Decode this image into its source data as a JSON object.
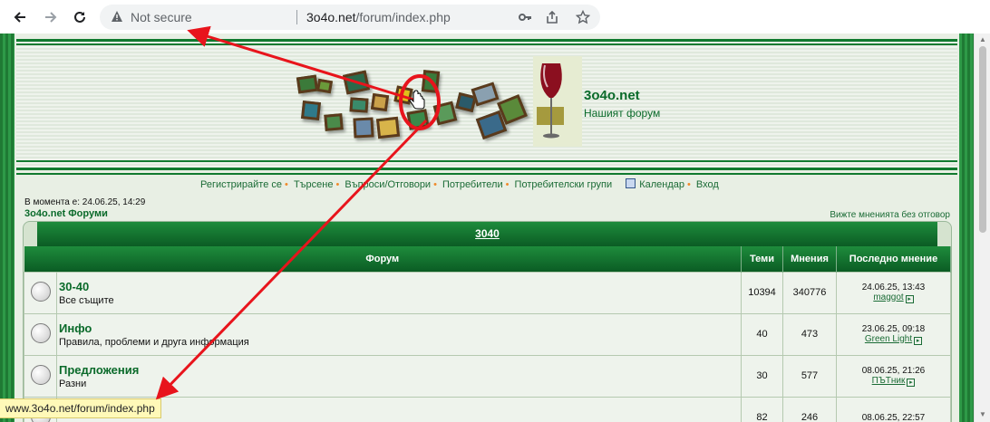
{
  "browser": {
    "security_label": "Not secure",
    "url_host": "3o4o.net",
    "url_path": "/forum/index.php",
    "status_url": "www.3o4o.net/forum/index.php"
  },
  "site": {
    "title": "3o4o.net",
    "subtitle": "Нашият форум"
  },
  "nav": {
    "items": [
      "Регистрирайте се",
      "Търсене",
      "Въпроси/Отговори",
      "Потребители",
      "Потребителски групи",
      "Календар",
      "Вход"
    ]
  },
  "board": {
    "current_time": "В момента е: 24.06.25, 14:29",
    "forums_link": "3o4o.net Форуми",
    "unanswered_link": "Вижте мненията без отговор",
    "category": "3040",
    "columns": {
      "forum": "Форум",
      "topics": "Теми",
      "posts": "Мнения",
      "last_post": "Последно мнение"
    },
    "forums": [
      {
        "name": "30-40",
        "description": "Все същите",
        "topics": "10394",
        "posts": "340776",
        "last_date": "24.06.25, 13:43",
        "last_user": "maggot"
      },
      {
        "name": "Инфо",
        "description": "Правила, проблеми и друга информация",
        "topics": "40",
        "posts": "473",
        "last_date": "23.06.25, 09:18",
        "last_user": "Green Light"
      },
      {
        "name": "Предложения",
        "description": "Разни",
        "topics": "30",
        "posts": "577",
        "last_date": "08.06.25, 21:26",
        "last_user": "ПЪТник"
      },
      {
        "name": "",
        "description": "",
        "topics": "82",
        "posts": "246",
        "last_date": "08.06.25, 22:57",
        "last_user": ""
      }
    ]
  },
  "colors": {
    "forum_green": "#117a2f",
    "annotation_red": "#e8141c",
    "status_yellow": "#fff9b8"
  }
}
